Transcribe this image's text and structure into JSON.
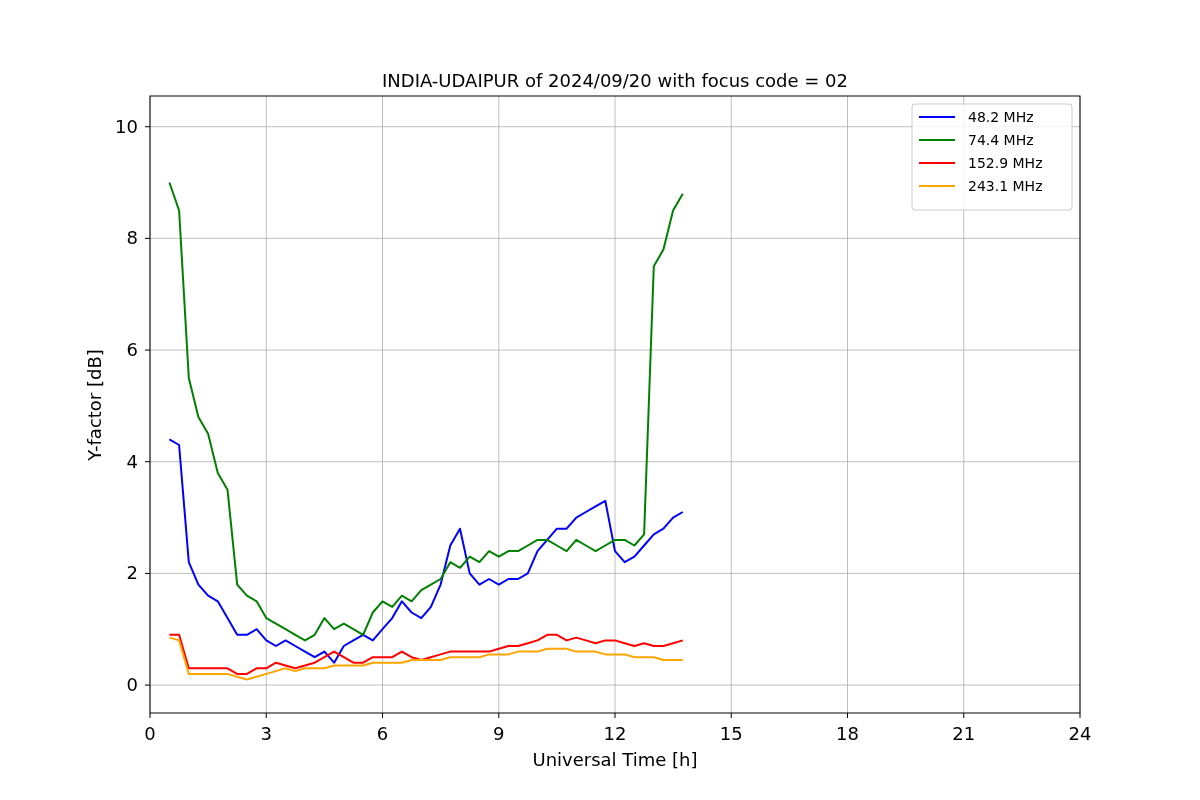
{
  "chart_data": {
    "type": "line",
    "title": "INDIA-UDAIPUR of 2024/09/20 with focus code = 02",
    "xlabel": "Universal Time [h]",
    "ylabel": "Y-factor [dB]",
    "x": [
      0.5,
      0.75,
      1,
      1.25,
      1.5,
      1.75,
      2,
      2.25,
      2.5,
      2.75,
      3,
      3.25,
      3.5,
      3.75,
      4,
      4.25,
      4.5,
      4.75,
      5,
      5.25,
      5.5,
      5.75,
      6,
      6.25,
      6.5,
      6.75,
      7,
      7.25,
      7.5,
      7.75,
      8,
      8.25,
      8.5,
      8.75,
      9,
      9.25,
      9.5,
      9.75,
      10,
      10.25,
      10.5,
      10.75,
      11,
      11.25,
      11.5,
      11.75,
      12,
      12.25,
      12.5,
      12.75,
      13,
      13.25,
      13.5,
      13.75
    ],
    "series": [
      {
        "name": "48.2 MHz",
        "color": "#0000ff",
        "values": [
          4.4,
          4.3,
          2.2,
          1.8,
          1.6,
          1.5,
          1.2,
          0.9,
          0.9,
          1.0,
          0.8,
          0.7,
          0.8,
          0.7,
          0.6,
          0.5,
          0.6,
          0.4,
          0.7,
          0.8,
          0.9,
          0.8,
          1.0,
          1.2,
          1.5,
          1.3,
          1.2,
          1.4,
          1.8,
          2.5,
          2.8,
          2.0,
          1.8,
          1.9,
          1.8,
          1.9,
          1.9,
          2.0,
          2.4,
          2.6,
          2.8,
          2.8,
          3.0,
          3.1,
          3.2,
          3.3,
          2.4,
          2.2,
          2.3,
          2.5,
          2.7,
          2.8,
          3.0,
          3.1
        ]
      },
      {
        "name": "74.4 MHz",
        "color": "#008000",
        "values": [
          9.0,
          8.5,
          5.5,
          4.8,
          4.5,
          3.8,
          3.5,
          1.8,
          1.6,
          1.5,
          1.2,
          1.1,
          1.0,
          0.9,
          0.8,
          0.9,
          1.2,
          1.0,
          1.1,
          1.0,
          0.9,
          1.3,
          1.5,
          1.4,
          1.6,
          1.5,
          1.7,
          1.8,
          1.9,
          2.2,
          2.1,
          2.3,
          2.2,
          2.4,
          2.3,
          2.4,
          2.4,
          2.5,
          2.6,
          2.6,
          2.5,
          2.4,
          2.6,
          2.5,
          2.4,
          2.5,
          2.6,
          2.6,
          2.5,
          2.7,
          7.5,
          7.8,
          8.5,
          8.8
        ]
      },
      {
        "name": "152.9 MHz",
        "color": "#ff0000",
        "values": [
          0.9,
          0.9,
          0.3,
          0.3,
          0.3,
          0.3,
          0.3,
          0.2,
          0.2,
          0.3,
          0.3,
          0.4,
          0.35,
          0.3,
          0.35,
          0.4,
          0.5,
          0.6,
          0.5,
          0.4,
          0.4,
          0.5,
          0.5,
          0.5,
          0.6,
          0.5,
          0.45,
          0.5,
          0.55,
          0.6,
          0.6,
          0.6,
          0.6,
          0.6,
          0.65,
          0.7,
          0.7,
          0.75,
          0.8,
          0.9,
          0.9,
          0.8,
          0.85,
          0.8,
          0.75,
          0.8,
          0.8,
          0.75,
          0.7,
          0.75,
          0.7,
          0.7,
          0.75,
          0.8
        ]
      },
      {
        "name": "243.1 MHz",
        "color": "#ffa500",
        "values": [
          0.85,
          0.8,
          0.2,
          0.2,
          0.2,
          0.2,
          0.2,
          0.15,
          0.1,
          0.15,
          0.2,
          0.25,
          0.3,
          0.25,
          0.3,
          0.3,
          0.3,
          0.35,
          0.35,
          0.35,
          0.35,
          0.4,
          0.4,
          0.4,
          0.4,
          0.45,
          0.45,
          0.45,
          0.45,
          0.5,
          0.5,
          0.5,
          0.5,
          0.55,
          0.55,
          0.55,
          0.6,
          0.6,
          0.6,
          0.65,
          0.65,
          0.65,
          0.6,
          0.6,
          0.6,
          0.55,
          0.55,
          0.55,
          0.5,
          0.5,
          0.5,
          0.45,
          0.45,
          0.45
        ]
      }
    ],
    "xlim": [
      0,
      24
    ],
    "ylim": [
      -0.5,
      10.55
    ],
    "xticks": [
      0,
      3,
      6,
      9,
      12,
      15,
      18,
      21,
      24
    ],
    "yticks": [
      0,
      2,
      4,
      6,
      8,
      10
    ],
    "grid": true,
    "legend": true
  }
}
